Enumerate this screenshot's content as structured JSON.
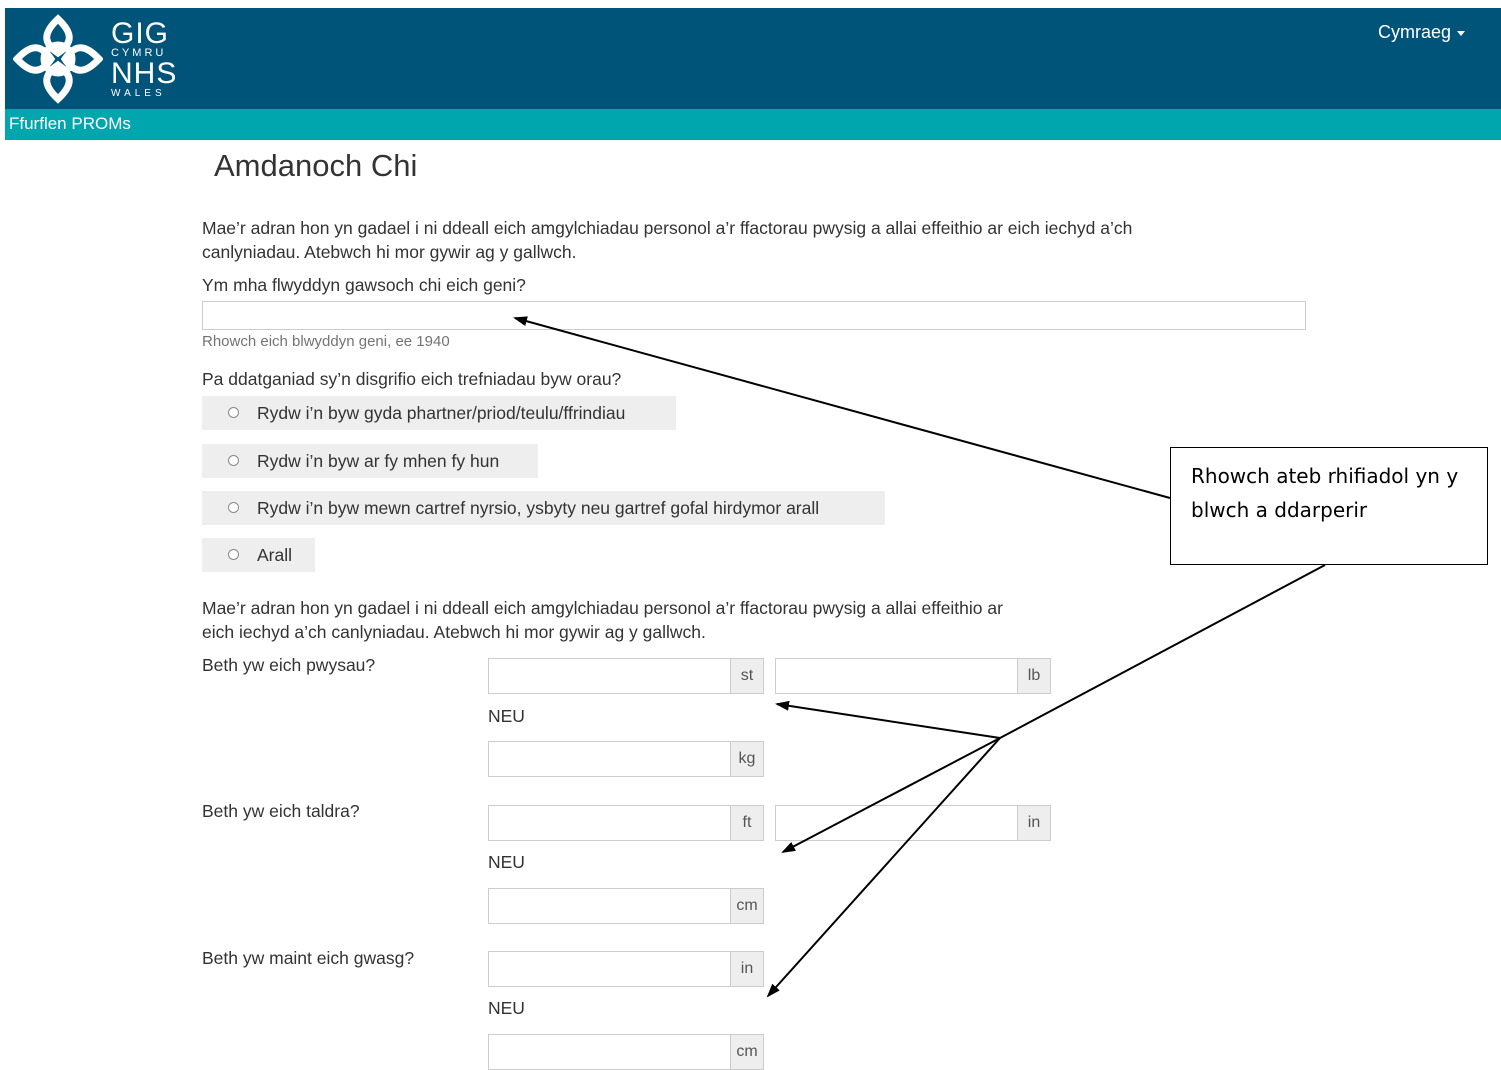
{
  "header": {
    "logo": {
      "gig": "GIG",
      "cymru": "CYMRU",
      "nhs": "NHS",
      "wales": "WALES"
    },
    "language": "Cymraeg"
  },
  "subbar": {
    "title": "Ffurflen PROMs"
  },
  "page": {
    "title": "Amdanoch Chi",
    "intro1": "Mae’r adran hon yn gadael i ni ddeall eich amgylchiadau personol a’r ffactorau pwysig a allai effeithio ar eich iechyd a’ch canlyniadau. Atebwch hi mor gywir ag y gallwch.",
    "birth_year": {
      "question": "Ym mha flwyddyn gawsoch chi eich geni?",
      "value": "",
      "help": "Rhowch eich blwyddyn geni, ee 1940"
    },
    "living": {
      "question": "Pa ddatganiad sy’n disgrifio eich trefniadau byw orau?",
      "options": [
        "Rydw i’n byw gyda phartner/priod/teulu/ffrindiau",
        "Rydw i’n byw ar fy mhen fy hun",
        "Rydw i’n byw mewn cartref nyrsio, ysbyty neu gartref gofal hirdymor arall",
        "Arall"
      ]
    },
    "intro2": "Mae’r adran hon yn gadael i ni ddeall eich amgylchiadau personol a’r ffactorau pwysig a allai effeithio ar eich iechyd a’ch canlyniadau. Atebwch hi mor gywir ag y gallwch.",
    "or_label": "NEU",
    "weight": {
      "question": "Beth yw eich pwysau?",
      "unit_st": "st",
      "unit_lb": "lb",
      "unit_kg": "kg"
    },
    "height": {
      "question": "Beth yw eich taldra?",
      "unit_ft": "ft",
      "unit_in": "in",
      "unit_cm": "cm"
    },
    "waist": {
      "question": "Beth yw maint eich gwasg?",
      "unit_in": "in",
      "unit_cm": "cm"
    }
  },
  "callout": {
    "text": "Rhowch ateb rhifiadol yn y blwch a ddarperir"
  }
}
